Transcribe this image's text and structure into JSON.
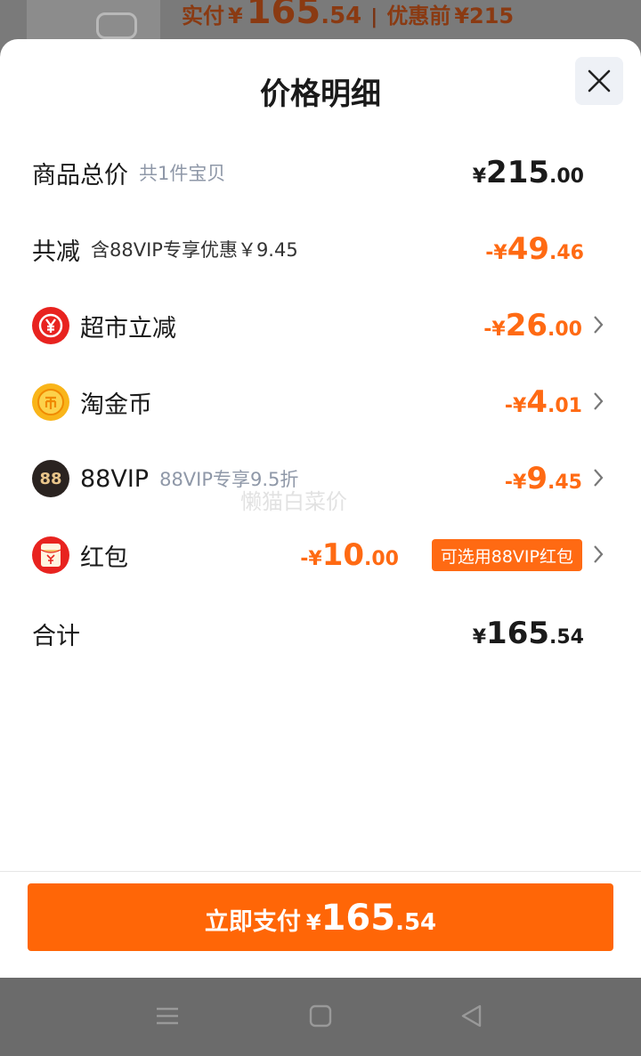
{
  "background": {
    "paid_label": "实付",
    "paid_currency": "¥",
    "paid_int": "165",
    "paid_dec": ".54",
    "separator": "|",
    "orig_label": "优惠前",
    "orig_value": "¥215"
  },
  "sheet": {
    "title": "价格明细"
  },
  "rows": {
    "total": {
      "label": "商品总价",
      "sub": "共1件宝贝",
      "cur": "¥",
      "int": "215",
      "dec": ".00"
    },
    "discount": {
      "label": "共减",
      "sub": "含88VIP专享优惠￥9.45",
      "cur": "-¥",
      "int": "49",
      "dec": ".46"
    },
    "supermarket": {
      "label": "超市立减",
      "cur": "-¥",
      "int": "26",
      "dec": ".00",
      "icon": "yen-badge-icon"
    },
    "coins": {
      "label": "淘金币",
      "cur": "-¥",
      "int": "4",
      "dec": ".01",
      "icon": "coin-icon"
    },
    "vip": {
      "label": "88VIP",
      "sub": "88VIP专享9.5折",
      "cur": "-¥",
      "int": "9",
      "dec": ".45",
      "icon": "vip-88-icon",
      "icon_text": "88"
    },
    "redpacket": {
      "label": "红包",
      "cur": "-¥",
      "int": "10",
      "dec": ".00",
      "tag": "可选用88VIP红包",
      "icon": "red-packet-icon"
    },
    "sum": {
      "label": "合计",
      "cur": "¥",
      "int": "165",
      "dec": ".54"
    }
  },
  "watermark": "懒猫白菜价",
  "pay_button": {
    "label": "立即支付",
    "cur": "¥",
    "int": "165",
    "dec": ".54"
  },
  "colors": {
    "accent": "#ff6607",
    "discount": "#ff6a13",
    "text": "#1a1a1a",
    "muted": "#8f98a8"
  }
}
